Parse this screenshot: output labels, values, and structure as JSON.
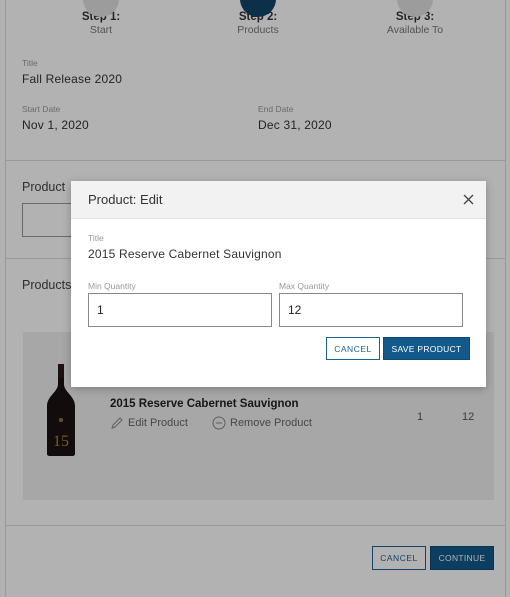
{
  "steps": [
    {
      "title": "Step 1:",
      "subtitle": "Start"
    },
    {
      "title": "Step 2:",
      "subtitle": "Products"
    },
    {
      "title": "Step 3:",
      "subtitle": "Available To"
    }
  ],
  "release": {
    "title_label": "Title",
    "title_value": "Fall Release 2020",
    "start_label": "Start Date",
    "start_value": "Nov 1, 2020",
    "end_label": "End Date",
    "end_value": "Dec 31, 2020"
  },
  "sections": {
    "product_search_label": "Product",
    "products_label": "Products"
  },
  "product_row": {
    "name": "2015 Reserve Cabernet Sauvignon",
    "edit_label": "Edit Product",
    "remove_label": "Remove Product",
    "min_qty": "1",
    "max_qty": "12",
    "bottle_number": "15"
  },
  "footer": {
    "cancel_label": "CANCEL",
    "continue_label": "CONTINUE"
  },
  "modal": {
    "title": "Product: Edit",
    "title_label": "Title",
    "title_value": "2015 Reserve Cabernet Sauvignon",
    "min_label": "Min Quantity",
    "min_value": "1",
    "max_label": "Max Quantity",
    "max_value": "12",
    "cancel_label": "CANCEL",
    "save_label": "SAVE PRODUCT"
  },
  "colors": {
    "primary": "#125a8c",
    "step_active": "#12456b",
    "overlay": "rgba(0,0,0,0.30)"
  }
}
